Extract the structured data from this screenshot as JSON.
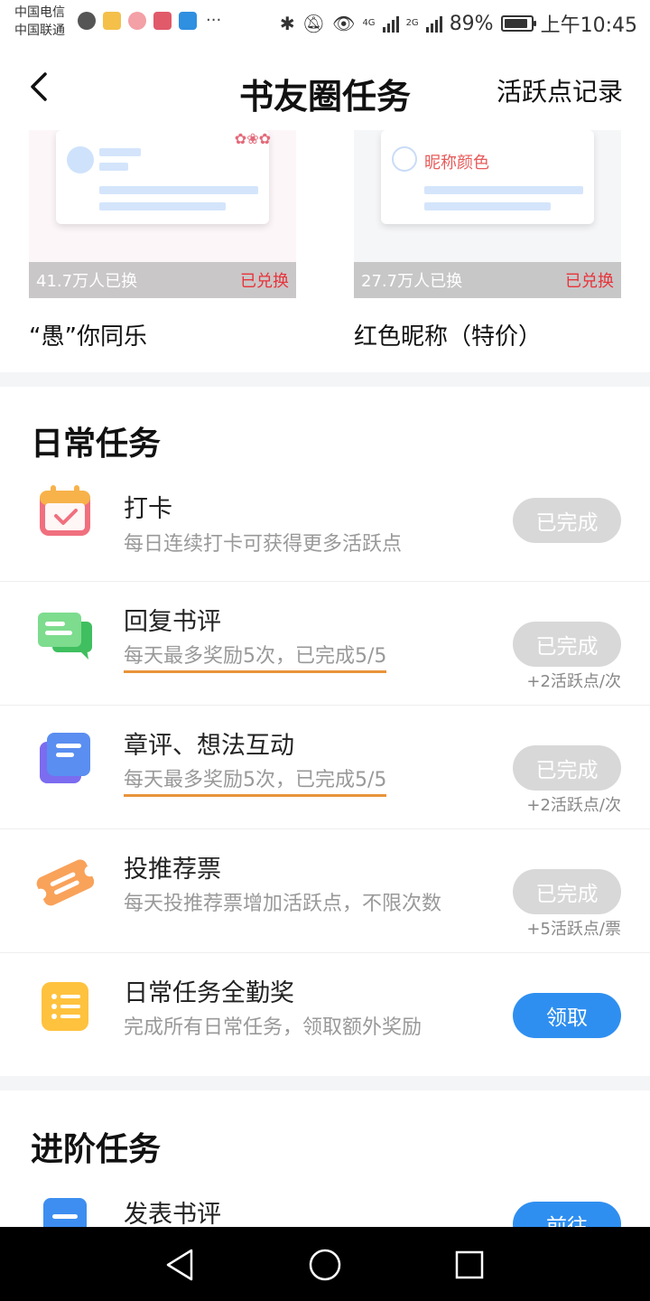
{
  "status_bar": {
    "carrier_1": "中国电信",
    "carrier_2": "中国联通",
    "battery": "89%",
    "battery_level": 0.89,
    "time": "上午10:45",
    "net_1": "4G",
    "net_2": "2G"
  },
  "header": {
    "title": "书友圈任务",
    "right_link": "活跃点记录",
    "back_icon": "chevron-left-icon"
  },
  "rewards": [
    {
      "title": "“愚”你同乐",
      "count": "41.7万人已换",
      "status": "已兑换"
    },
    {
      "title": "红色昵称（特价）",
      "count": "27.7万人已换",
      "status": "已兑换",
      "preview_label": "昵称颜色"
    }
  ],
  "daily": {
    "title": "日常任务",
    "tasks": [
      {
        "icon": "calendar-check-icon",
        "title": "打卡",
        "desc": "每日连续打卡可获得更多活跃点",
        "button": "已完成",
        "note": ""
      },
      {
        "icon": "chat-bubble-icon",
        "title": "回复书评",
        "desc": "每天最多奖励5次，已完成5/5",
        "button": "已完成",
        "note": "+2活跃点/次"
      },
      {
        "icon": "document-stack-icon",
        "title": "章评、想法互动",
        "desc": "每天最多奖励5次，已完成5/5",
        "button": "已完成",
        "note": "+2活跃点/次"
      },
      {
        "icon": "ticket-icon",
        "title": "投推荐票",
        "desc": "每天投推荐票增加活跃点，不限次数",
        "button": "已完成",
        "note": "+5活跃点/票"
      },
      {
        "icon": "list-icon",
        "title": "日常任务全勤奖",
        "desc": "完成所有日常任务，领取额外奖励",
        "button": "领取",
        "note": ""
      }
    ]
  },
  "advanced": {
    "title": "进阶任务",
    "tasks": [
      {
        "icon": "document-icon",
        "title": "发表书评",
        "button": "前往"
      }
    ]
  },
  "colors": {
    "primary_button": "#2f8ff0",
    "done_button": "#d8d8d8",
    "redeemed_red": "#e8333a",
    "progress_underline": "#e8943a"
  }
}
